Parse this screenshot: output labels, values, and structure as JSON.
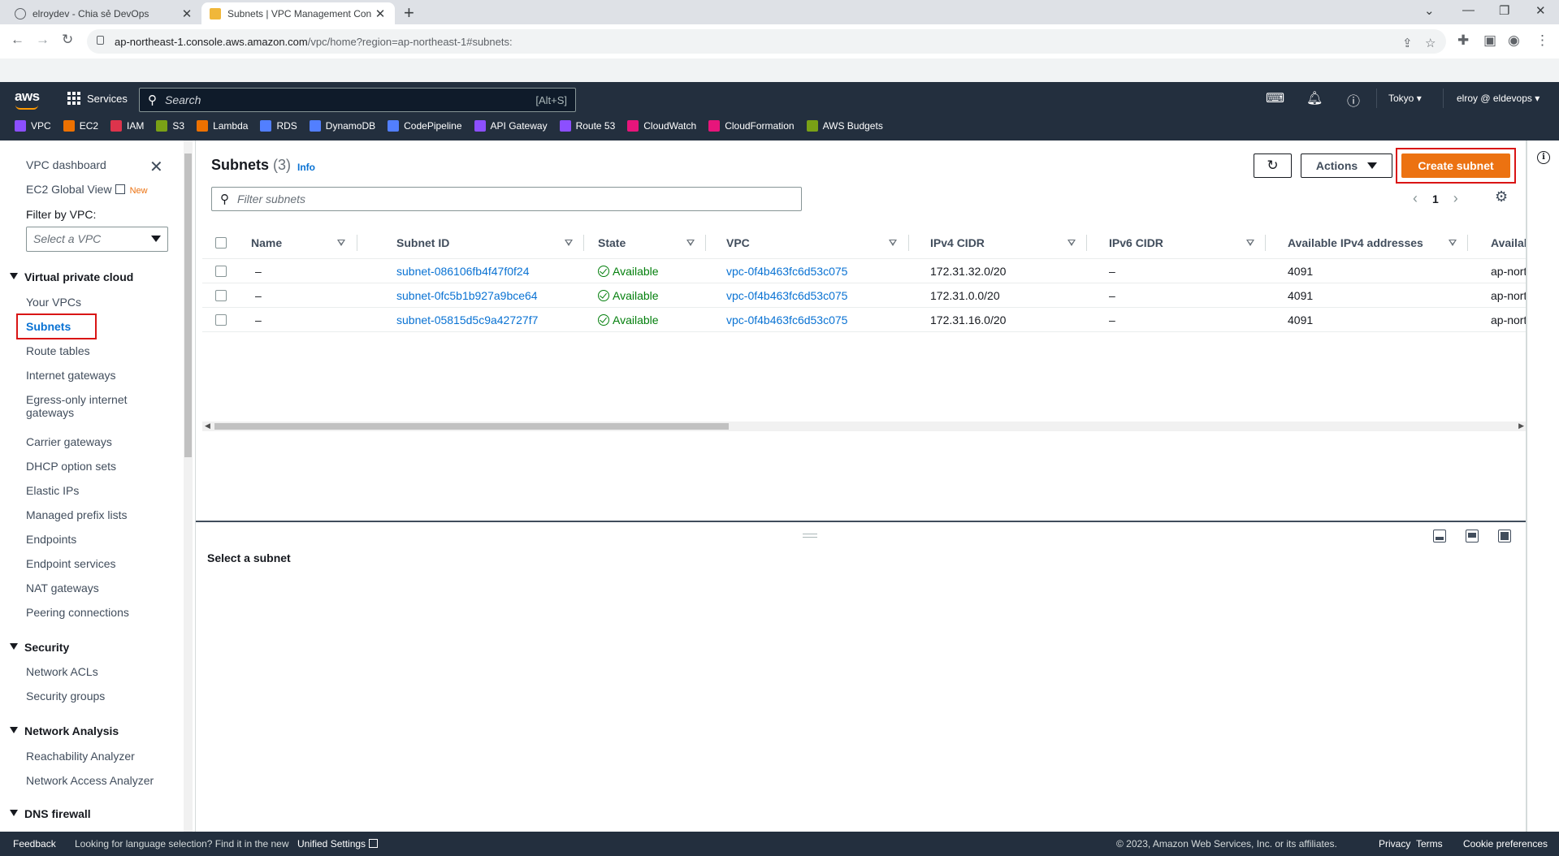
{
  "browser": {
    "tabs": [
      {
        "title": "elroydev - Chia sẻ DevOps"
      },
      {
        "title": "Subnets | VPC Management Con"
      }
    ],
    "url_host": "ap-northeast-1.console.aws.amazon.com",
    "url_path": "/vpc/home?region=ap-northeast-1#subnets:"
  },
  "aws_nav": {
    "logo": "aws",
    "services_label": "Services",
    "search_placeholder": "Search",
    "search_shortcut": "[Alt+S]",
    "region": "Tokyo",
    "account": "elroy @ eldevops",
    "favorites": [
      {
        "label": "VPC",
        "color": "#8c4fff"
      },
      {
        "label": "EC2",
        "color": "#ed7100"
      },
      {
        "label": "IAM",
        "color": "#dd344c"
      },
      {
        "label": "S3",
        "color": "#7aa116"
      },
      {
        "label": "Lambda",
        "color": "#ed7100"
      },
      {
        "label": "RDS",
        "color": "#527fff"
      },
      {
        "label": "DynamoDB",
        "color": "#527fff"
      },
      {
        "label": "CodePipeline",
        "color": "#527fff"
      },
      {
        "label": "API Gateway",
        "color": "#8c4fff"
      },
      {
        "label": "Route 53",
        "color": "#8c4fff"
      },
      {
        "label": "CloudWatch",
        "color": "#e7157b"
      },
      {
        "label": "CloudFormation",
        "color": "#e7157b"
      },
      {
        "label": "AWS Budgets",
        "color": "#7aa116"
      }
    ]
  },
  "sidebar": {
    "dashboard": "VPC dashboard",
    "global_view": "EC2 Global View",
    "new_badge": "New",
    "filter_label": "Filter by VPC:",
    "filter_placeholder": "Select a VPC",
    "sections": {
      "vpc": "Virtual private cloud",
      "security": "Security",
      "network_analysis": "Network Analysis",
      "dns_firewall": "DNS firewall"
    },
    "items": {
      "your_vpcs": "Your VPCs",
      "subnets": "Subnets",
      "route_tables": "Route tables",
      "internet_gateways": "Internet gateways",
      "egress_1": "Egress-only internet",
      "egress_2": "gateways",
      "carrier_gateways": "Carrier gateways",
      "dhcp": "DHCP option sets",
      "elastic_ips": "Elastic IPs",
      "prefix_lists": "Managed prefix lists",
      "endpoints": "Endpoints",
      "endpoint_services": "Endpoint services",
      "nat_gateways": "NAT gateways",
      "peering": "Peering connections",
      "network_acls": "Network ACLs",
      "security_groups": "Security groups",
      "reachability": "Reachability Analyzer",
      "network_access": "Network Access Analyzer"
    }
  },
  "main": {
    "title": "Subnets",
    "count": "(3)",
    "info": "Info",
    "actions_label": "Actions",
    "create_label": "Create subnet",
    "filter_placeholder": "Filter subnets",
    "page_number": "1",
    "columns": [
      "Name",
      "Subnet ID",
      "State",
      "VPC",
      "IPv4 CIDR",
      "IPv6 CIDR",
      "Available IPv4 addresses",
      "Availab"
    ],
    "rows": [
      {
        "name": "–",
        "subnet_id": "subnet-086106fb4f47f0f24",
        "state": "Available",
        "vpc": "vpc-0f4b463fc6d53c075",
        "ipv4": "172.31.32.0/20",
        "ipv6": "–",
        "avail": "4091",
        "az": "ap-nort"
      },
      {
        "name": "–",
        "subnet_id": "subnet-0fc5b1b927a9bce64",
        "state": "Available",
        "vpc": "vpc-0f4b463fc6d53c075",
        "ipv4": "172.31.0.0/20",
        "ipv6": "–",
        "avail": "4091",
        "az": "ap-nort"
      },
      {
        "name": "–",
        "subnet_id": "subnet-05815d5c9a42727f7",
        "state": "Available",
        "vpc": "vpc-0f4b463fc6d53c075",
        "ipv4": "172.31.16.0/20",
        "ipv6": "–",
        "avail": "4091",
        "az": "ap-nort"
      }
    ],
    "detail_prompt": "Select a subnet"
  },
  "footer": {
    "feedback": "Feedback",
    "language_note": "Looking for language selection? Find it in the new",
    "unified_settings": "Unified Settings",
    "copyright": "© 2023, Amazon Web Services, Inc. or its affiliates.",
    "privacy": "Privacy",
    "terms": "Terms",
    "cookies": "Cookie preferences"
  },
  "colors": {
    "aws_nav_bg": "#232f3e",
    "primary_orange": "#ec7211",
    "link_blue": "#0972d3",
    "success_green": "#037f0c",
    "highlight_red": "#d91515"
  }
}
